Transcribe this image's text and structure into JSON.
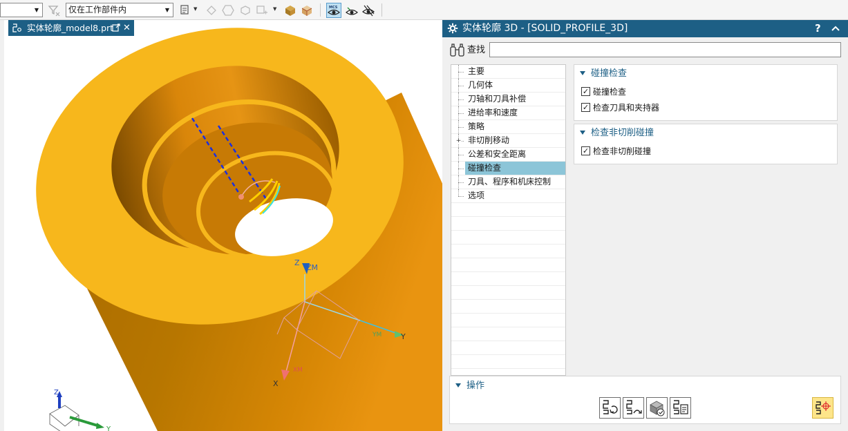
{
  "toolbar": {
    "select1_value": "",
    "select2_value": "仅在工作部件内"
  },
  "viewport": {
    "tab_label": "实体轮廓_model8.prt",
    "tab_close": "✕",
    "axis_labels": {
      "zm": "ZM",
      "z": "Z",
      "y": "Y",
      "x": "X",
      "ym": "YM",
      "xm": "XM",
      "tri_z": "Z",
      "tri_y": "Y"
    }
  },
  "dialog": {
    "title": "实体轮廓 3D - [SOLID_PROFILE_3D]",
    "help": "?",
    "find": {
      "label": "查找",
      "value": ""
    },
    "nav": [
      {
        "label": "主要"
      },
      {
        "label": "几何体"
      },
      {
        "label": "刀轴和刀具补偿"
      },
      {
        "label": "进给率和速度"
      },
      {
        "label": "策略"
      },
      {
        "label": "非切削移动",
        "expandable": true
      },
      {
        "label": "公差和安全距离"
      },
      {
        "label": "碰撞检查",
        "selected": true
      },
      {
        "label": "刀具、程序和机床控制"
      },
      {
        "label": "选项"
      }
    ],
    "collision_section": {
      "title": "碰撞检查",
      "items": [
        {
          "label": "碰撞检查",
          "checked": true
        },
        {
          "label": "检查刀具和夹持器",
          "checked": true
        }
      ]
    },
    "noncut_section": {
      "title": "检查非切削碰撞",
      "items": [
        {
          "label": "检查非切削碰撞",
          "checked": true
        }
      ]
    },
    "actions": {
      "title": "操作"
    }
  },
  "colors": {
    "title_bar": "#1d5f85",
    "part_yellow": "#f7b71c",
    "part_orange": "#d97f06",
    "nav_selected": "#8cc5d8"
  }
}
